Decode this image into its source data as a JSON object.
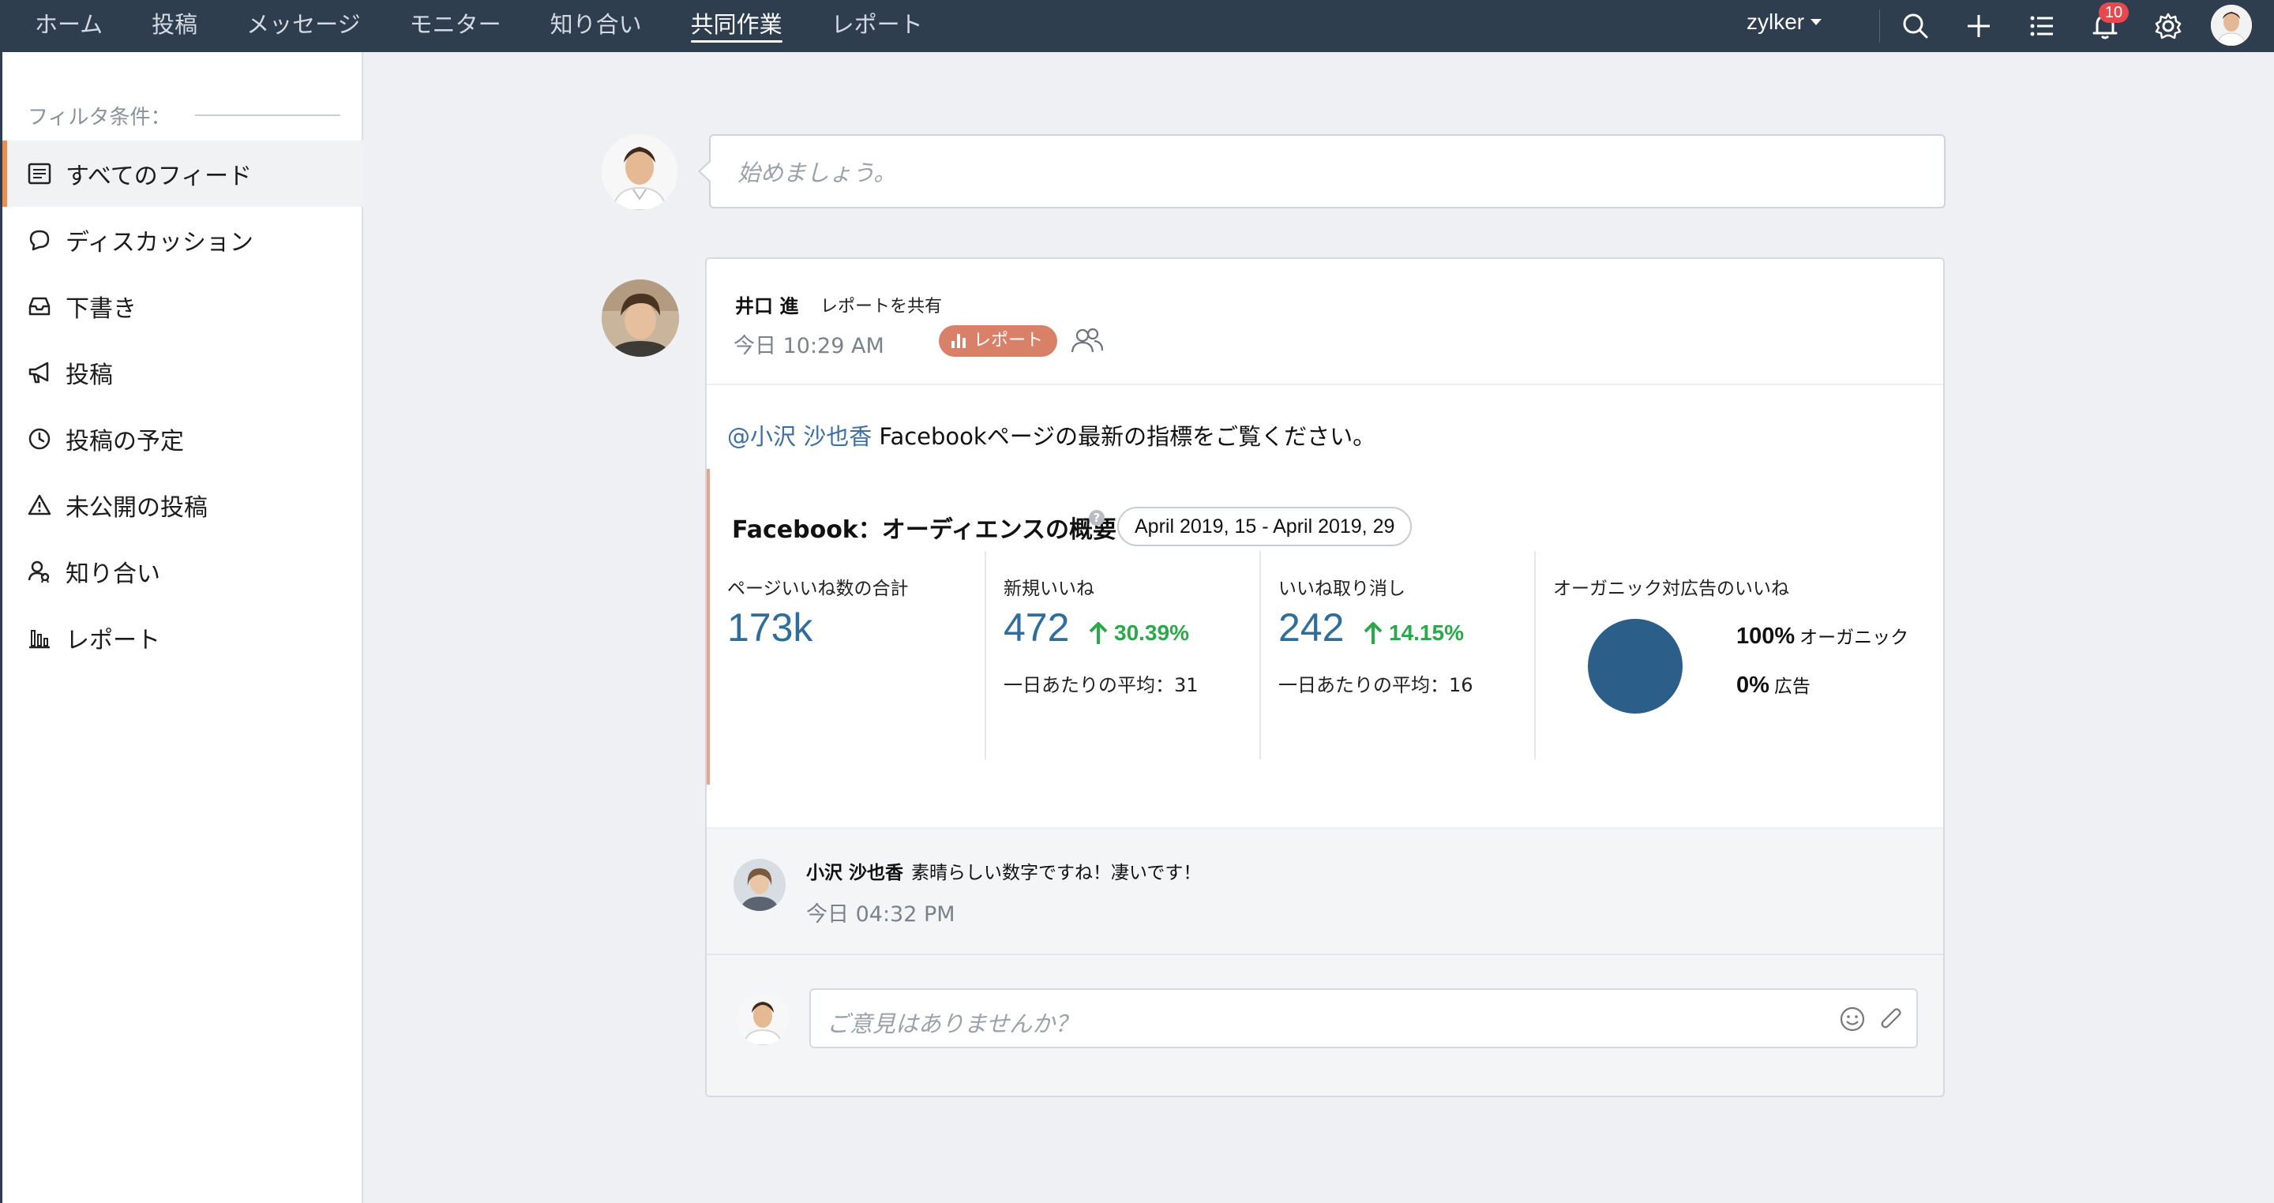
{
  "nav": {
    "items": [
      "ホーム",
      "投稿",
      "メッセージ",
      "モニター",
      "知り合い",
      "共同作業",
      "レポート"
    ],
    "active_index": 5,
    "org_name": "zylker",
    "notification_count": "10"
  },
  "sidebar": {
    "filter_label": "フィルタ条件：",
    "items": [
      {
        "label": "すべてのフィード",
        "icon": "feed-icon",
        "active": true
      },
      {
        "label": "ディスカッション",
        "icon": "chat-icon"
      },
      {
        "label": "下書き",
        "icon": "inbox-icon"
      },
      {
        "label": "投稿",
        "icon": "megaphone-icon"
      },
      {
        "label": "投稿の予定",
        "icon": "clock-icon"
      },
      {
        "label": "未公開の投稿",
        "icon": "warning-icon"
      },
      {
        "label": "知り合い",
        "icon": "contacts-icon"
      },
      {
        "label": "レポート",
        "icon": "bar-chart-icon"
      }
    ]
  },
  "composer": {
    "placeholder": "始めましょう。"
  },
  "post": {
    "author": "井口 進",
    "action": "レポートを共有",
    "time": "今日 10:29 AM",
    "tag": "レポート",
    "mention": "@小沢 沙也香",
    "message": " Facebookページの最新の指標をご覧ください。",
    "report": {
      "title": "Facebook：オーディエンスの概要",
      "date_range": "April 2019, 15 - April 2019, 29",
      "metrics": [
        {
          "label": "ページいいね数の合計",
          "value": "173k"
        },
        {
          "label": "新規いいね",
          "value": "472",
          "change": "30.39%",
          "avg": "一日あたりの平均：31"
        },
        {
          "label": "いいね取り消し",
          "value": "242",
          "change": "14.15%",
          "avg": "一日あたりの平均：16"
        }
      ],
      "pie": {
        "label": "オーガニック対広告のいいね",
        "organic_pct": "100%",
        "organic_label": "オーガニック",
        "ads_pct": "0%",
        "ads_label": "広告",
        "organic_value": 100,
        "ads_value": 0,
        "color": "#2b5f89"
      }
    },
    "comment": {
      "author": "小沢 沙也香",
      "text": "素晴らしい数字ですね！凄いです！",
      "time": "今日 04:32 PM"
    },
    "reply_placeholder": "ご意見はありませんか？"
  },
  "colors": {
    "nav_bg": "#2f3e4f",
    "accent": "#f08c4e",
    "tag_bg": "#d98168",
    "metric_value": "#2f6e9c",
    "positive": "#2ba84a"
  }
}
